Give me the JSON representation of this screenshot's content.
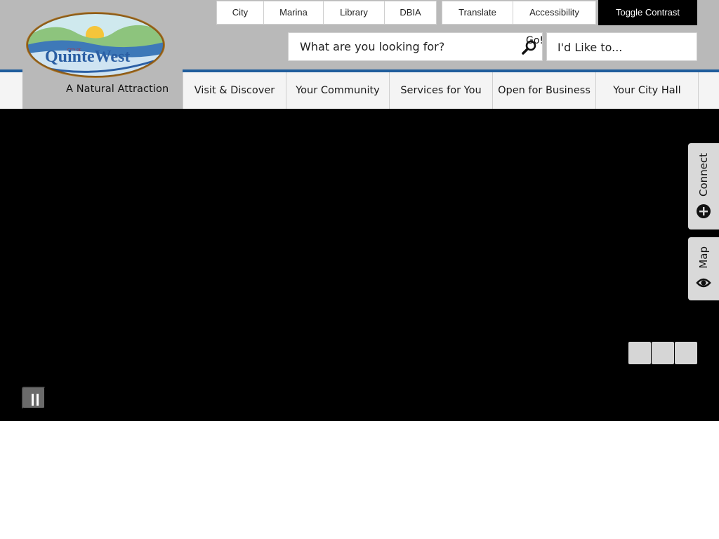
{
  "logo": {
    "city_of": "CITY OF",
    "name": "QuinteWest",
    "tagline": "A Natural Attraction"
  },
  "utility_links": [
    [
      {
        "label": "City"
      },
      {
        "label": "Marina"
      },
      {
        "label": "Library"
      },
      {
        "label": "DBIA"
      }
    ],
    [
      {
        "label": "Translate"
      },
      {
        "label": "Accessibility"
      }
    ]
  ],
  "toggle_contrast": "Toggle Contrast",
  "search": {
    "placeholder": "What are you looking for?",
    "go_label": "Go!"
  },
  "id_like": "I'd Like to...",
  "main_nav": [
    {
      "label": "Visit & Discover"
    },
    {
      "label": "Your Community"
    },
    {
      "label": "Services for You"
    },
    {
      "label": "Open for Business"
    },
    {
      "label": "Your City Hall"
    }
  ],
  "side_tabs": {
    "connect": "Connect",
    "map": "Map"
  },
  "colors": {
    "header": "#b9b9b9",
    "accent_blue": "#1f5d9c",
    "hero": "#000000",
    "contrast_button": "#000000"
  },
  "icons": {
    "search": "magnifier-icon",
    "connect": "plus-circle-icon",
    "map": "eye-pin-icon",
    "pause": "pause-icon"
  }
}
